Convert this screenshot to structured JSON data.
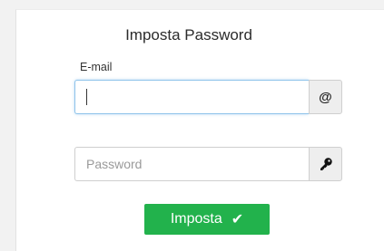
{
  "form": {
    "title": "Imposta Password",
    "email_label": "E-mail",
    "email_value": "",
    "email_addon": "@",
    "password_placeholder": "Password",
    "submit_label": "Imposta",
    "submit_icon": "✔"
  },
  "icons": {
    "email": "at-sign-icon",
    "password": "key-icon",
    "submit": "checkmark-icon"
  },
  "colors": {
    "submit_background": "#22b24c",
    "focus_border": "#8ec3ea"
  }
}
